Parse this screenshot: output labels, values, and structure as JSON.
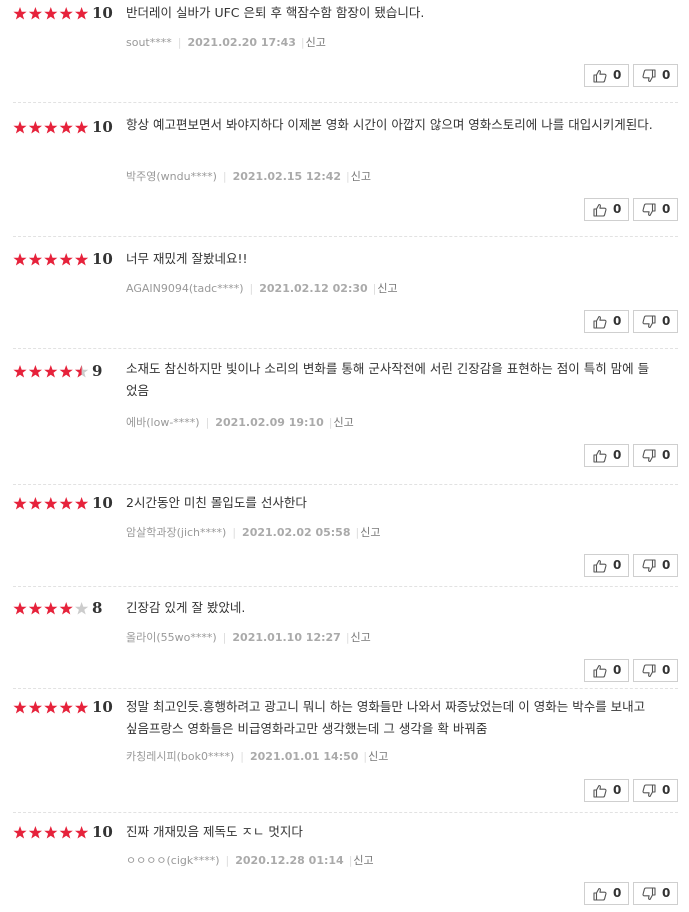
{
  "colors": {
    "star_on": "#e6223b",
    "star_off": "#cccccc"
  },
  "reviews": [
    {
      "rating": 5,
      "score": "10",
      "text": "반더레이 실바가 UFC 은퇴 후 핵잠수함 함장이 됐습니다.",
      "author": "sout****",
      "date": "2021.02.20 17:43",
      "report": "신고",
      "likes": "0",
      "dislikes": "0"
    },
    {
      "rating": 5,
      "score": "10",
      "text": "항상 예고편보면서 봐야지하다 이제본 영화 시간이 아깝지 않으며 영화스토리에 나를 대입시키게된다.",
      "author": "박주영(wndu****)",
      "date": "2021.02.15 12:42",
      "report": "신고",
      "likes": "0",
      "dislikes": "0"
    },
    {
      "rating": 5,
      "score": "10",
      "text": "너무 재밌게 잘봤네요!!",
      "author": "AGAIN9094(tadc****)",
      "date": "2021.02.12 02:30",
      "report": "신고",
      "likes": "0",
      "dislikes": "0"
    },
    {
      "rating": 4.5,
      "score": "9",
      "text": "소재도 참신하지만 빛이나 소리의 변화를 통해 군사작전에 서린 긴장감을 표현하는 점이 특히 맘에 들었음",
      "author": "에바(low-****)",
      "date": "2021.02.09 19:10",
      "report": "신고",
      "likes": "0",
      "dislikes": "0"
    },
    {
      "rating": 5,
      "score": "10",
      "text": "2시간동안 미친 몰입도를 선사한다",
      "author": "암살학과장(jich****)",
      "date": "2021.02.02 05:58",
      "report": "신고",
      "likes": "0",
      "dislikes": "0"
    },
    {
      "rating": 4,
      "score": "8",
      "text": "긴장감 있게 잘 봤았네.",
      "author": "올라이(55wo****)",
      "date": "2021.01.10 12:27",
      "report": "신고",
      "likes": "0",
      "dislikes": "0"
    },
    {
      "rating": 5,
      "score": "10",
      "text": "정말 최고인듯.흥행하려고 광고니 뭐니 하는 영화들만 나와서 짜증났었는데 이 영화는 박수를 보내고 싶음프랑스 영화들은 비급영화라고만 생각했는데 그 생각을 확 바꿔줌",
      "author": "카칭레시피(bok0****)",
      "date": "2021.01.01 14:50",
      "report": "신고",
      "likes": "0",
      "dislikes": "0"
    },
    {
      "rating": 5,
      "score": "10",
      "text": "진짜 개재밌음 제독도 ㅈㄴ 멋지다",
      "author": "ㅇㅇㅇㅇ(cigk****)",
      "date": "2020.12.28 01:14",
      "report": "신고",
      "likes": "0",
      "dislikes": "0"
    }
  ]
}
